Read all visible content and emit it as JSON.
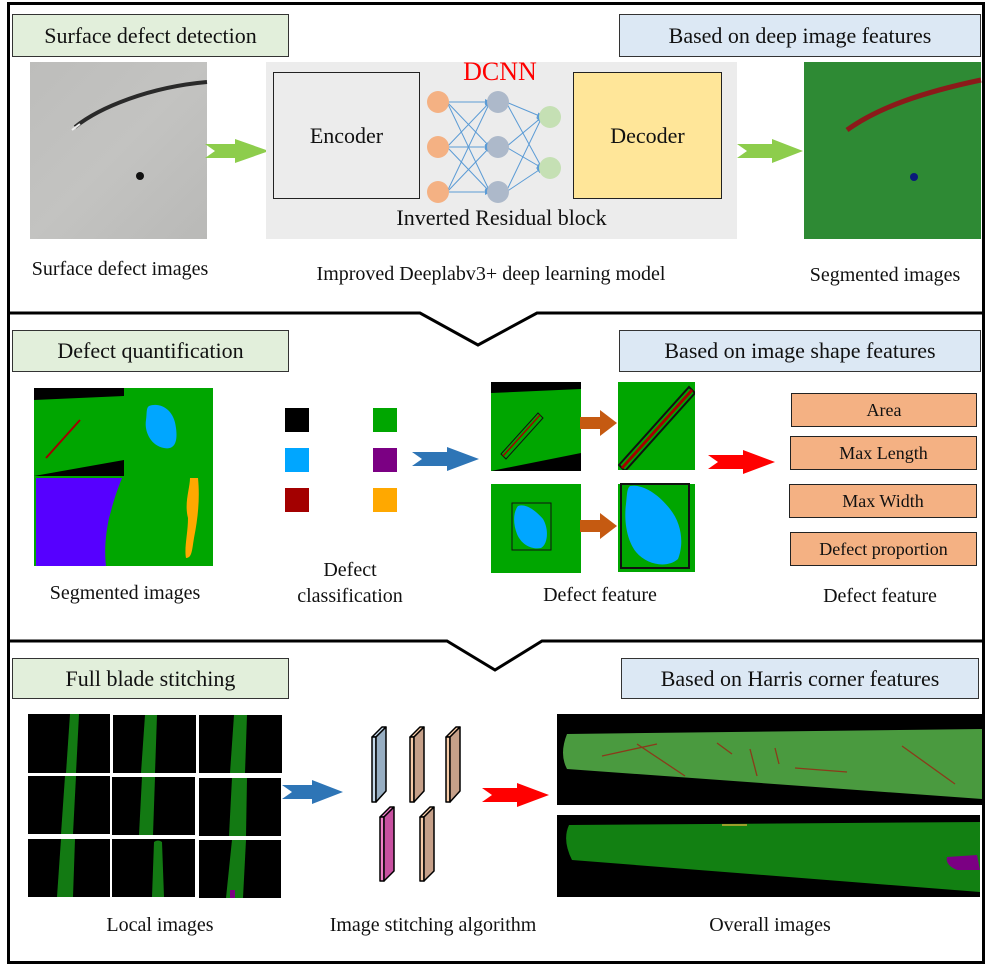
{
  "sections": {
    "detection": {
      "title": "Surface defect detection",
      "basis": "Based on deep image features",
      "input_caption": "Surface defect images",
      "model": {
        "network_label": "DCNN",
        "encoder": "Encoder",
        "decoder": "Decoder",
        "block_label": "Inverted Residual block",
        "caption": "Improved Deeplabv3+ deep learning model"
      },
      "output_caption": "Segmented images"
    },
    "quantification": {
      "title": "Defect quantification",
      "basis": "Based on image shape features",
      "segmented_caption": "Segmented images",
      "classification_caption_line1": "Defect",
      "classification_caption_line2": "classification",
      "class_colors": [
        "#000000",
        "#00a600",
        "#00a6ff",
        "#7b0083",
        "#a30000",
        "#ffa800"
      ],
      "feature_image_caption": "Defect feature",
      "features": [
        "Area",
        "Max Length",
        "Max Width",
        "Defect proportion"
      ],
      "feature_list_caption": "Defect feature"
    },
    "stitching": {
      "title": "Full blade stitching",
      "basis": "Based on Harris corner features",
      "local_caption": "Local images",
      "algorithm_caption": "Image stitching algorithm",
      "overall_caption": "Overall images"
    }
  },
  "colors": {
    "title_tag_bg": "#e2efdb",
    "basis_tag_bg": "#dce8f4",
    "decoder_bg": "#ffe699",
    "feature_bg": "#f4b183",
    "dcnn_label": "#ff0000",
    "green_arrow": "#8dcd4c",
    "blue_arrow": "#2e75b6",
    "orange_arrow": "#c55a11",
    "red_arrow": "#ff0000"
  }
}
